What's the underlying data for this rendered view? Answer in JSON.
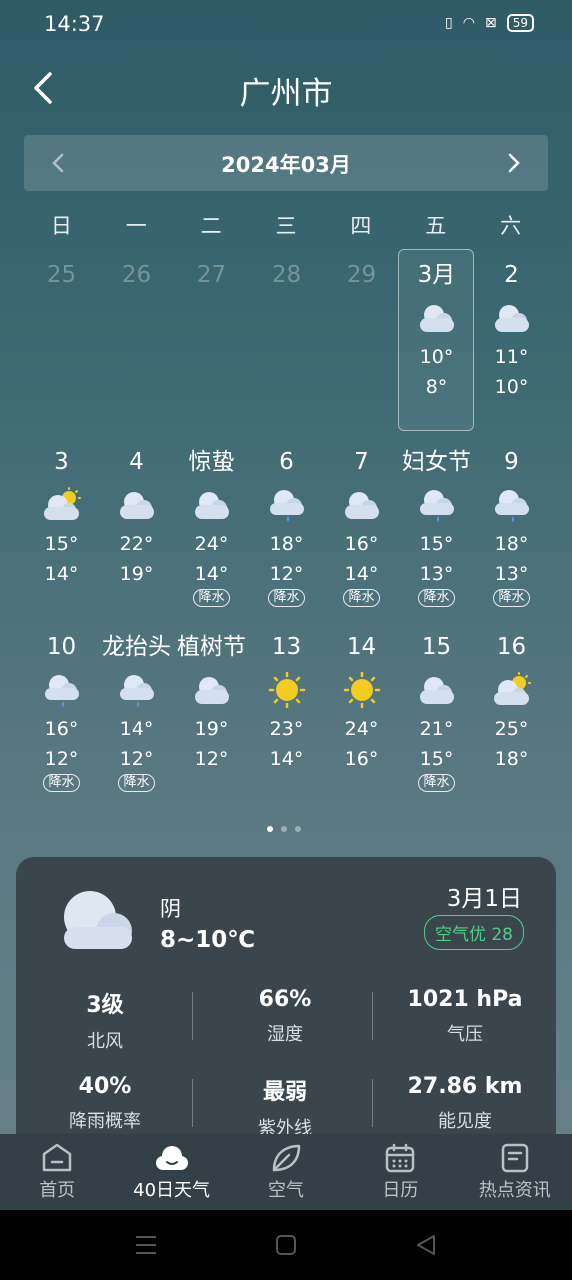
{
  "status": {
    "time": "14:37",
    "battery": "59"
  },
  "header": {
    "city": "广州市"
  },
  "month": {
    "label": "2024年03月"
  },
  "weekdays": [
    "日",
    "一",
    "二",
    "三",
    "四",
    "五",
    "六"
  ],
  "days": [
    {
      "label": "25",
      "dim": true
    },
    {
      "label": "26",
      "dim": true
    },
    {
      "label": "27",
      "dim": true
    },
    {
      "label": "28",
      "dim": true
    },
    {
      "label": "29",
      "dim": true
    },
    {
      "label": "3月",
      "icon": "cloudy-icon",
      "hi": "10°",
      "lo": "8°",
      "selected": true
    },
    {
      "label": "2",
      "icon": "cloudy-icon",
      "hi": "11°",
      "lo": "10°"
    },
    {
      "label": "3",
      "icon": "partly-cloudy-icon",
      "hi": "15°",
      "lo": "14°"
    },
    {
      "label": "4",
      "icon": "cloudy-icon",
      "hi": "22°",
      "lo": "19°"
    },
    {
      "label": "惊蛰",
      "icon": "cloudy-icon",
      "hi": "24°",
      "lo": "14°",
      "tag": "降水"
    },
    {
      "label": "6",
      "icon": "rain-icon",
      "hi": "18°",
      "lo": "12°",
      "tag": "降水"
    },
    {
      "label": "7",
      "icon": "cloudy-icon",
      "hi": "16°",
      "lo": "14°",
      "tag": "降水"
    },
    {
      "label": "妇女节",
      "icon": "rain-icon",
      "hi": "15°",
      "lo": "13°",
      "tag": "降水"
    },
    {
      "label": "9",
      "icon": "rain-icon",
      "hi": "18°",
      "lo": "13°",
      "tag": "降水"
    },
    {
      "label": "10",
      "icon": "rain-icon",
      "hi": "16°",
      "lo": "12°",
      "tag": "降水"
    },
    {
      "label": "龙抬头",
      "icon": "rain-icon",
      "hi": "14°",
      "lo": "12°",
      "tag": "降水"
    },
    {
      "label": "植树节",
      "icon": "cloudy-icon",
      "hi": "19°",
      "lo": "12°"
    },
    {
      "label": "13",
      "icon": "sunny-icon",
      "hi": "23°",
      "lo": "14°"
    },
    {
      "label": "14",
      "icon": "sunny-icon",
      "hi": "24°",
      "lo": "16°"
    },
    {
      "label": "15",
      "icon": "cloudy-icon",
      "hi": "21°",
      "lo": "15°",
      "tag": "降水"
    },
    {
      "label": "16",
      "icon": "partly-cloudy-icon",
      "hi": "25°",
      "lo": "18°"
    }
  ],
  "detail": {
    "condition": "阴",
    "range": "8~10℃",
    "date": "3月1日",
    "aqi": "空气优 28",
    "stats": [
      {
        "value": "3级",
        "label": "北风"
      },
      {
        "value": "66%",
        "label": "湿度"
      },
      {
        "value": "1021 hPa",
        "label": "气压"
      },
      {
        "value": "40%",
        "label": "降雨概率"
      },
      {
        "value": "最弱",
        "label": "紫外线"
      },
      {
        "value": "27.86 km",
        "label": "能见度"
      }
    ]
  },
  "tabs": [
    {
      "label": "首页",
      "icon": "home-icon"
    },
    {
      "label": "40日天气",
      "icon": "cloud-icon",
      "active": true
    },
    {
      "label": "空气",
      "icon": "leaf-icon"
    },
    {
      "label": "日历",
      "icon": "calendar-icon"
    },
    {
      "label": "热点资讯",
      "icon": "news-icon"
    }
  ],
  "colors": {
    "accent": "#4fcf86",
    "card": "#3a464c",
    "tabbar": "#334047"
  }
}
